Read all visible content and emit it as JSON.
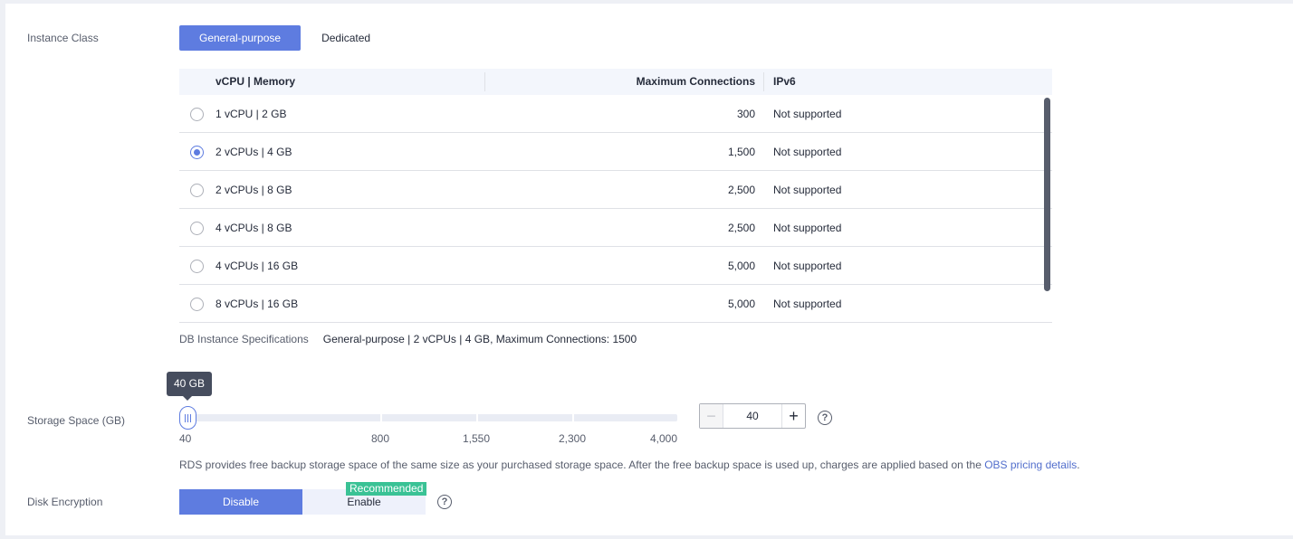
{
  "instance_class": {
    "label": "Instance Class",
    "tabs": [
      {
        "label": "General-purpose",
        "active": true
      },
      {
        "label": "Dedicated",
        "active": false
      }
    ]
  },
  "table": {
    "headers": {
      "spec": "vCPU | Memory",
      "connections": "Maximum Connections",
      "ipv6": "IPv6"
    },
    "rows": [
      {
        "spec": "1 vCPU | 2 GB",
        "connections": "300",
        "ipv6": "Not supported",
        "selected": false
      },
      {
        "spec": "2 vCPUs | 4 GB",
        "connections": "1,500",
        "ipv6": "Not supported",
        "selected": true
      },
      {
        "spec": "2 vCPUs | 8 GB",
        "connections": "2,500",
        "ipv6": "Not supported",
        "selected": false
      },
      {
        "spec": "4 vCPUs | 8 GB",
        "connections": "2,500",
        "ipv6": "Not supported",
        "selected": false
      },
      {
        "spec": "4 vCPUs | 16 GB",
        "connections": "5,000",
        "ipv6": "Not supported",
        "selected": false
      },
      {
        "spec": "8 vCPUs | 16 GB",
        "connections": "5,000",
        "ipv6": "Not supported",
        "selected": false
      }
    ]
  },
  "spec_summary": {
    "label": "DB Instance Specifications",
    "value": "General-purpose | 2 vCPUs | 4 GB, Maximum Connections: 1500"
  },
  "storage": {
    "label": "Storage Space (GB)",
    "tooltip": "40 GB",
    "ticks": [
      "40",
      "800",
      "1,550",
      "2,300",
      "4,000"
    ],
    "value": "40",
    "minus": "−",
    "plus": "+",
    "help": "?",
    "note_text": "RDS provides free backup storage space of the same size as your purchased storage space. After the free backup space is used up, charges are applied based on the ",
    "note_link": "OBS pricing details",
    "note_end": "."
  },
  "disk_encryption": {
    "label": "Disk Encryption",
    "options": [
      {
        "label": "Disable",
        "active": true
      },
      {
        "label": "Enable",
        "active": false
      }
    ],
    "badge": "Recommended",
    "help": "?"
  },
  "colors": {
    "accent": "#5e7ce0",
    "badge": "#3ac295",
    "link": "#526ecc"
  },
  "icons": [
    "radio-icon",
    "slider-grip-icon",
    "question-circle-icon"
  ]
}
